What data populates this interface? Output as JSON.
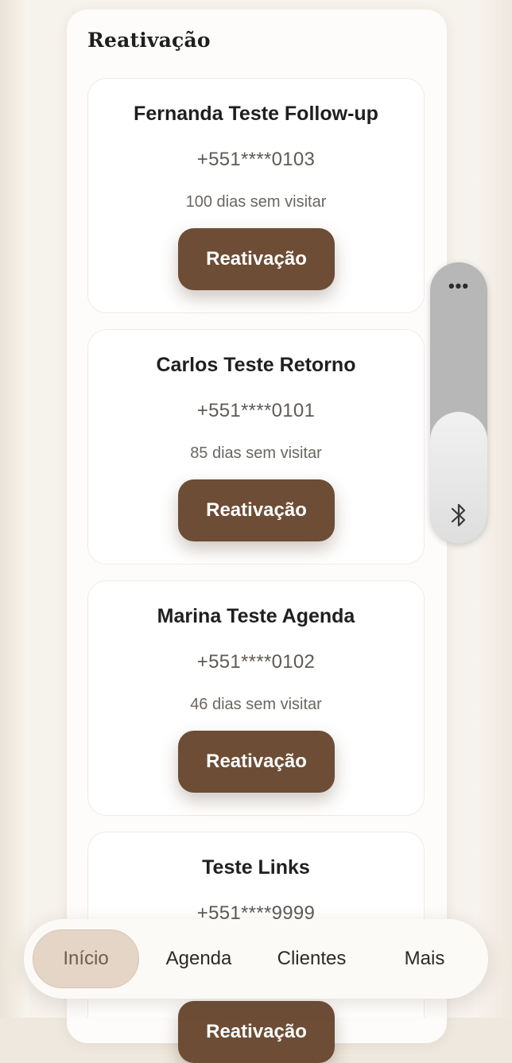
{
  "section": {
    "title": "Reativação"
  },
  "cards": [
    {
      "name": "Fernanda Teste Follow-up",
      "phone": "+551****0103",
      "days": "100 dias sem visitar",
      "button": "Reativação"
    },
    {
      "name": "Carlos Teste Retorno",
      "phone": "+551****0101",
      "days": "85 dias sem visitar",
      "button": "Reativação"
    },
    {
      "name": "Marina Teste Agenda",
      "phone": "+551****0102",
      "days": "46 dias sem visitar",
      "button": "Reativação"
    },
    {
      "name": "Teste Links",
      "phone": "+551****9999",
      "days": "",
      "button": "Reativação"
    }
  ],
  "scroll_widget": {
    "menu_icon": "more-horizontal-icon",
    "bottom_icon": "bluetooth-icon"
  },
  "nav": {
    "items": [
      {
        "label": "Início",
        "active": true
      },
      {
        "label": "Agenda",
        "active": false
      },
      {
        "label": "Clientes",
        "active": false
      },
      {
        "label": "Mais",
        "active": false
      }
    ]
  },
  "colors": {
    "accent": "#6d4d35",
    "active_tab": "#e5d5c6",
    "background": "#efe8de"
  }
}
